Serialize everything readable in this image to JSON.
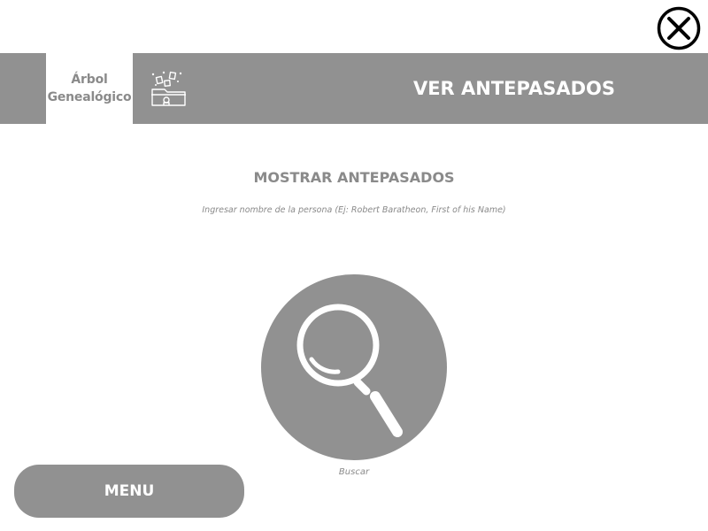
{
  "header": {
    "logo_line1": "Árbol",
    "logo_line2": "Genealógico",
    "title": "VER ANTEPASADOS",
    "icon": "folder-icon"
  },
  "close": {
    "icon": "close-icon"
  },
  "main": {
    "section_title": "MOSTRAR ANTEPASADOS",
    "hint": "Ingresar nombre de la persona (Ej: Robert Baratheon, First of his Name)",
    "search_label": "Buscar",
    "search_icon": "search-icon"
  },
  "footer": {
    "menu_label": "MENU"
  },
  "colors": {
    "bar_gray": "#919191",
    "text_gray": "#8a8a8a",
    "white": "#ffffff"
  }
}
